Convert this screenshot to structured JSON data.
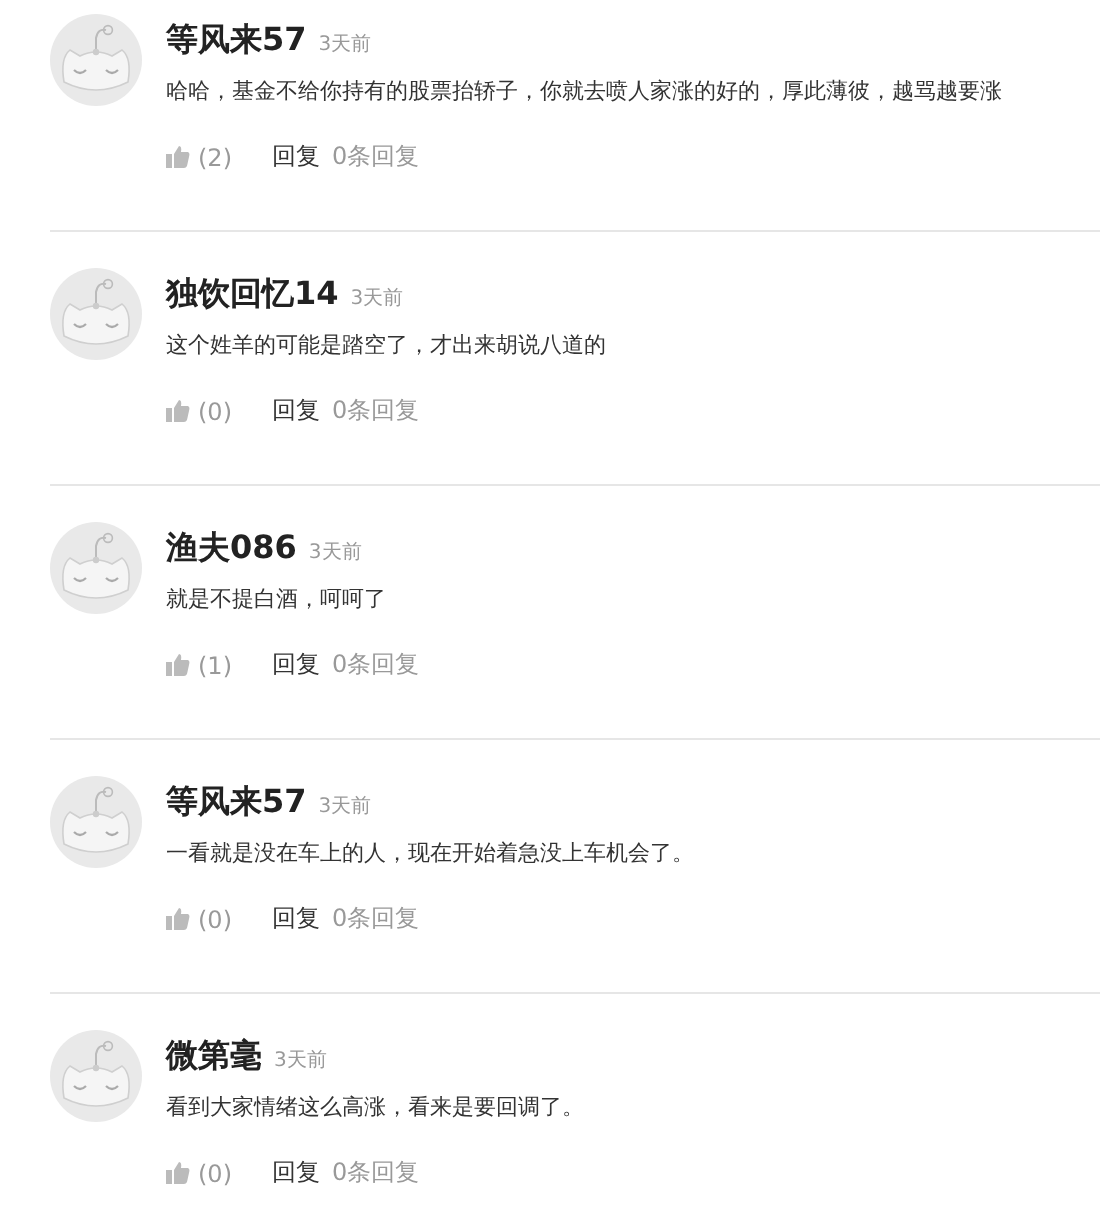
{
  "comments": [
    {
      "user": "等风来57",
      "time": "3天前",
      "text": "哈哈，基金不给你持有的股票抬轿子，你就去喷人家涨的好的，厚此薄彼，越骂越要涨",
      "likes": "(2)",
      "reply": "回复",
      "reply_count": "0条回复"
    },
    {
      "user": "独饮回忆14",
      "time": "3天前",
      "text": "这个姓羊的可能是踏空了，才出来胡说八道的",
      "likes": "(0)",
      "reply": "回复",
      "reply_count": "0条回复"
    },
    {
      "user": "渔夫086",
      "time": "3天前",
      "text": "就是不提白酒，呵呵了",
      "likes": "(1)",
      "reply": "回复",
      "reply_count": "0条回复"
    },
    {
      "user": "等风来57",
      "time": "3天前",
      "text": "一看就是没在车上的人，现在开始着急没上车机会了。",
      "likes": "(0)",
      "reply": "回复",
      "reply_count": "0条回复"
    },
    {
      "user": "微第毫",
      "time": "3天前",
      "text": "看到大家情绪这么高涨，看来是要回调了。",
      "likes": "(0)",
      "reply": "回复",
      "reply_count": "0条回复"
    }
  ]
}
